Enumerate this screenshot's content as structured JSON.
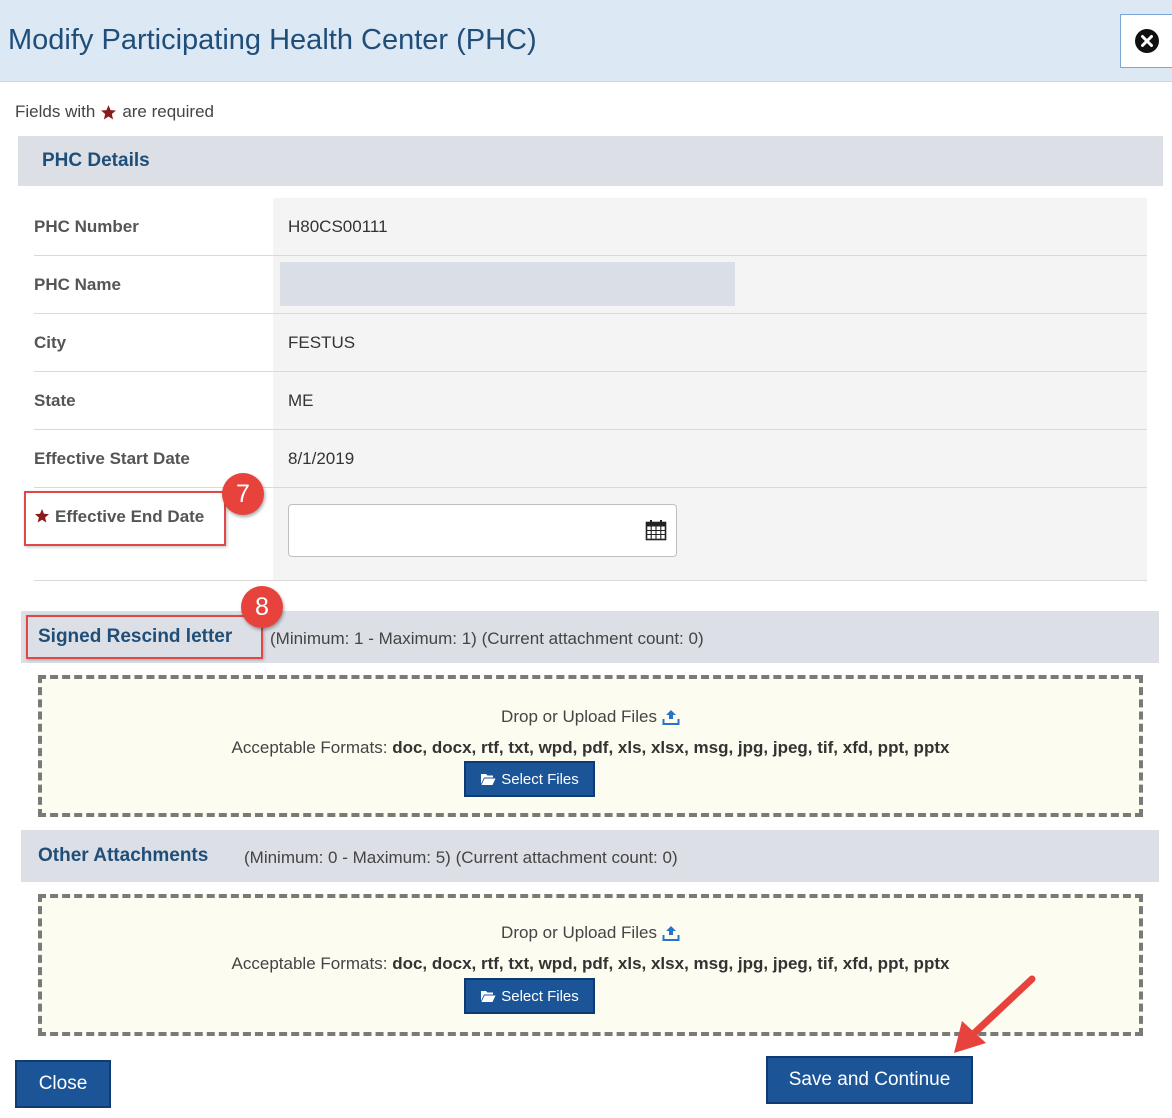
{
  "dialog": {
    "title": "Modify Participating Health Center (PHC)",
    "required_note_prefix": "Fields with",
    "required_note_suffix": "are required"
  },
  "details": {
    "section_title": "PHC Details",
    "rows": [
      {
        "label": "PHC Number",
        "value": "H80CS00111"
      },
      {
        "label": "PHC Name",
        "value": ""
      },
      {
        "label": "City",
        "value": "FESTUS"
      },
      {
        "label": "State",
        "value": "ME"
      },
      {
        "label": "Effective Start Date",
        "value": "8/1/2019"
      }
    ],
    "end_date": {
      "label": "Effective End Date",
      "value": ""
    }
  },
  "annotations": {
    "end_date_badge": "7",
    "rescind_badge": "8"
  },
  "attachments": {
    "rescind": {
      "title": "Signed Rescind letter",
      "meta": "(Minimum: 1 - Maximum: 1) (Current attachment count: 0)"
    },
    "other": {
      "title": "Other Attachments",
      "meta": "(Minimum: 0 - Maximum: 5) (Current attachment count: 0)"
    },
    "drop_label": "Drop or Upload Files",
    "formats_label": "Acceptable Formats:",
    "formats_list": "doc, docx, rtf, txt, wpd, pdf, xls, xlsx, msg, jpg, jpeg, tif, xfd, ppt, pptx",
    "select_label": "Select Files"
  },
  "footer": {
    "close_label": "Close",
    "save_label": "Save and Continue"
  },
  "colors": {
    "accent": "#1c5597",
    "header_bg": "#dde8f5",
    "required_star": "#8b1a1a",
    "annotation": "#e8423c"
  },
  "icons": [
    "close-circle-icon",
    "required-star-icon",
    "calendar-icon",
    "upload-icon",
    "folder-open-icon",
    "arrow-annotation"
  ]
}
